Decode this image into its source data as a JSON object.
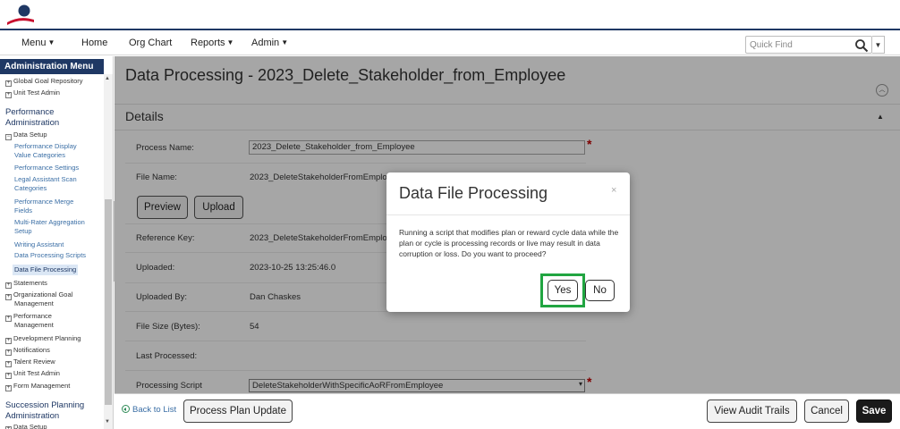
{
  "nav": {
    "items": [
      {
        "label": "Menu",
        "caret": true
      },
      {
        "label": "Home",
        "caret": false
      },
      {
        "label": "Org Chart",
        "caret": false
      },
      {
        "label": "Reports",
        "caret": true
      },
      {
        "label": "Admin",
        "caret": true
      }
    ],
    "quick_find_placeholder": "Quick Find"
  },
  "sidebar": {
    "header": "Administration Menu",
    "lines": [
      {
        "text": "Global Goal Repository",
        "kind": "root"
      },
      {
        "text": "Unit Test Admin",
        "kind": "root"
      },
      {
        "text": "Performance",
        "kind": "section"
      },
      {
        "text": "Administration",
        "kind": "section"
      },
      {
        "text": "Data Setup",
        "kind": "root-open"
      },
      {
        "text": "Performance Display",
        "kind": "link"
      },
      {
        "text": "Value Categories",
        "kind": "link"
      },
      {
        "text": "Performance Settings",
        "kind": "link"
      },
      {
        "text": "Legal Assistant Scan",
        "kind": "link"
      },
      {
        "text": "Categories",
        "kind": "link"
      },
      {
        "text": "Performance Merge",
        "kind": "link"
      },
      {
        "text": "Fields",
        "kind": "link"
      },
      {
        "text": "Multi-Rater Aggregation",
        "kind": "link"
      },
      {
        "text": "Setup",
        "kind": "link"
      },
      {
        "text": "Writing Assistant",
        "kind": "link"
      },
      {
        "text": "Data Processing Scripts",
        "kind": "link"
      },
      {
        "text": "Data File Processing",
        "kind": "active"
      },
      {
        "text": "Statements",
        "kind": "root"
      },
      {
        "text": "Organizational Goal",
        "kind": "root"
      },
      {
        "text": "Management",
        "kind": "cont"
      },
      {
        "text": "Performance",
        "kind": "root"
      },
      {
        "text": "Management",
        "kind": "cont"
      },
      {
        "text": "Development Planning",
        "kind": "root"
      },
      {
        "text": "Notifications",
        "kind": "root"
      },
      {
        "text": "Talent Review",
        "kind": "root"
      },
      {
        "text": "Unit Test Admin",
        "kind": "root"
      },
      {
        "text": "Form Management",
        "kind": "root"
      },
      {
        "text": "Succession Planning",
        "kind": "section"
      },
      {
        "text": "Administration",
        "kind": "section"
      },
      {
        "text": "Data Setup",
        "kind": "root"
      }
    ]
  },
  "page": {
    "title": "Data Processing - 2023_Delete_Stakeholder_from_Employee",
    "section_title": "Details",
    "fields": {
      "process_name_label": "Process Name:",
      "process_name_value": "2023_Delete_Stakeholder_from_Employee",
      "file_name_label": "File Name:",
      "file_name_value": "2023_DeleteStakeholderFromEmploye",
      "preview_label": "Preview",
      "upload_label": "Upload",
      "reference_key_label": "Reference Key:",
      "reference_key_value": "2023_DeleteStakeholderFromEmploye",
      "uploaded_label": "Uploaded:",
      "uploaded_value": "2023-10-25 13:25:46.0",
      "uploaded_by_label": "Uploaded By:",
      "uploaded_by_value": "Dan Chaskes",
      "file_size_label": "File Size (Bytes):",
      "file_size_value": "54",
      "last_processed_label": "Last Processed:",
      "last_processed_value": "",
      "processing_script_label": "Processing Script",
      "processing_script_value": "DeleteStakeholderWithSpecificAoRFromEmployee"
    }
  },
  "footer": {
    "back_label": "Back to List",
    "process_update_label": "Process Plan Update",
    "audit_label": "View Audit Trails",
    "cancel_label": "Cancel",
    "save_label": "Save"
  },
  "modal": {
    "title": "Data File Processing",
    "close": "×",
    "body": "Running a script that modifies plan or reward cycle data while the plan or cycle is processing records or live may result in data corruption or loss. Do you want to proceed?",
    "yes_label": "Yes",
    "no_label": "No"
  },
  "colors": {
    "brand_navy": "#1f3864",
    "logo_red": "#c8102e",
    "highlight_green": "#21a541",
    "required_red": "#c00000"
  }
}
